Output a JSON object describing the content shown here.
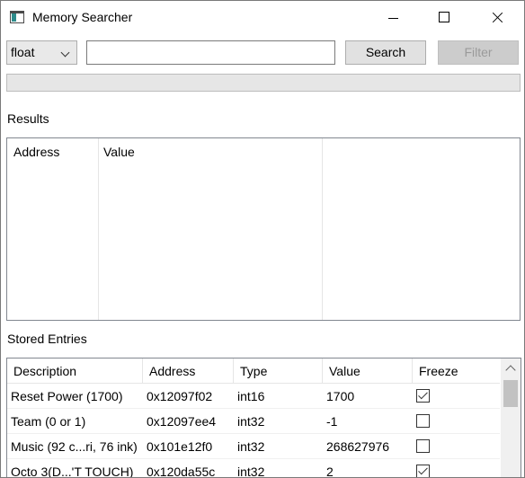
{
  "window": {
    "title": "Memory Searcher"
  },
  "toolbar": {
    "type_selected": "float",
    "search_value": "",
    "search_label": "Search",
    "filter_label": "Filter",
    "progress": 0
  },
  "results": {
    "label": "Results",
    "columns": [
      "Address",
      "Value"
    ]
  },
  "stored": {
    "label": "Stored Entries",
    "columns": [
      "Description",
      "Address",
      "Type",
      "Value",
      "Freeze"
    ],
    "rows": [
      {
        "description": "Reset Power (1700)",
        "address": "0x12097f02",
        "type": "int16",
        "value": "1700",
        "freeze": true
      },
      {
        "description": "Team (0 or 1)",
        "address": "0x12097ee4",
        "type": "int32",
        "value": "-1",
        "freeze": false
      },
      {
        "description": "Music (92 c...ri, 76 ink)",
        "address": "0x101e12f0",
        "type": "int32",
        "value": "268627976",
        "freeze": false
      },
      {
        "description": "Octo 3(D...'T TOUCH)",
        "address": "0x120da55c",
        "type": "int32",
        "value": "2",
        "freeze": true
      }
    ]
  }
}
